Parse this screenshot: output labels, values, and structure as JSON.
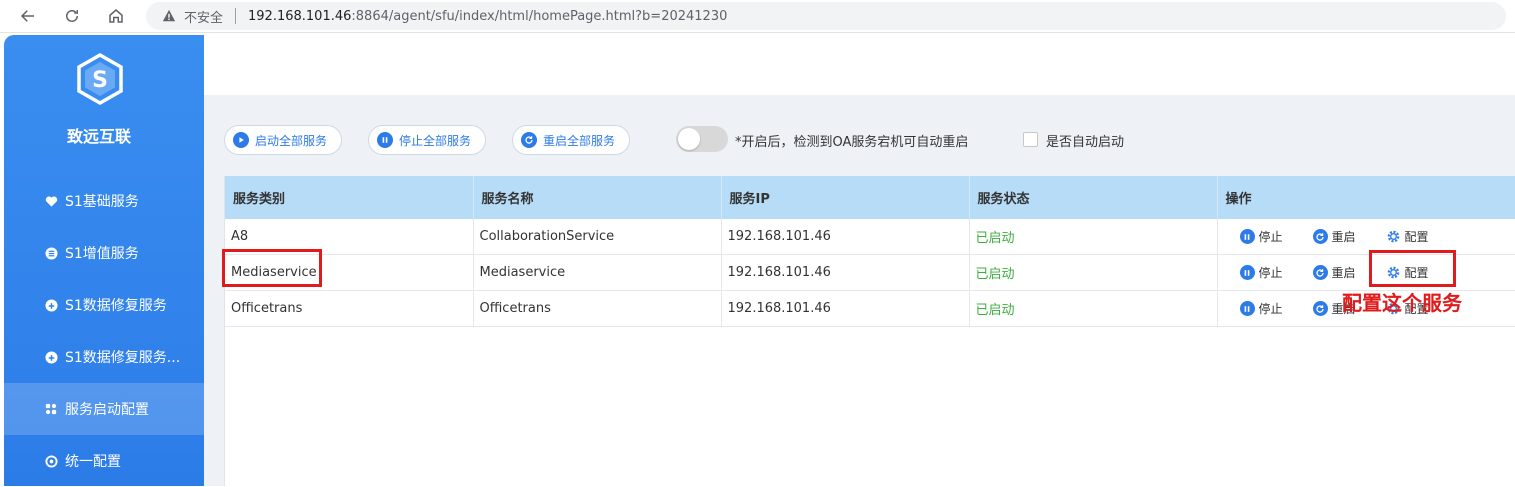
{
  "browser": {
    "insecure_label": "不安全",
    "url_host": "192.168.101.46",
    "url_rest": ":8864/agent/sfu/index/html/homePage.html?b=20241230"
  },
  "sidebar": {
    "brand": "致远互联",
    "items": [
      {
        "label": "S1基础服务",
        "icon": "heart-icon"
      },
      {
        "label": "S1增值服务",
        "icon": "list-icon"
      },
      {
        "label": "S1数据修复服务",
        "icon": "repair-icon"
      },
      {
        "label": "S1数据修复服务...",
        "icon": "repair-icon"
      },
      {
        "label": "服务启动配置",
        "icon": "grid-icon",
        "active": true
      },
      {
        "label": "统一配置",
        "icon": "target-icon"
      }
    ]
  },
  "toolbar": {
    "start_all": "启动全部服务",
    "stop_all": "停止全部服务",
    "restart_all": "重启全部服务",
    "toggle_text": "*开启后，检测到OA服务宕机可自动重启",
    "auto_start_label": "是否自动启动"
  },
  "table": {
    "headers": [
      "服务类别",
      "服务名称",
      "服务IP",
      "服务状态",
      "操作"
    ],
    "rows": [
      {
        "category": "A8",
        "name": "CollaborationService",
        "ip": "192.168.101.46",
        "status": "已启动"
      },
      {
        "category": "Mediaservice",
        "name": "Mediaservice",
        "ip": "192.168.101.46",
        "status": "已启动"
      },
      {
        "category": "Officetrans",
        "name": "Officetrans",
        "ip": "192.168.101.46",
        "status": "已启动"
      }
    ],
    "ops": {
      "stop": "停止",
      "restart": "重启",
      "config": "配置"
    }
  },
  "annotation": {
    "text": "配置这个服务",
    "color": "#e11b1b"
  },
  "colors": {
    "accent": "#2d7be8",
    "sidebar": "#3a8ef0",
    "status_ok": "#3dae3d",
    "header_bg": "#b7dcf7"
  }
}
